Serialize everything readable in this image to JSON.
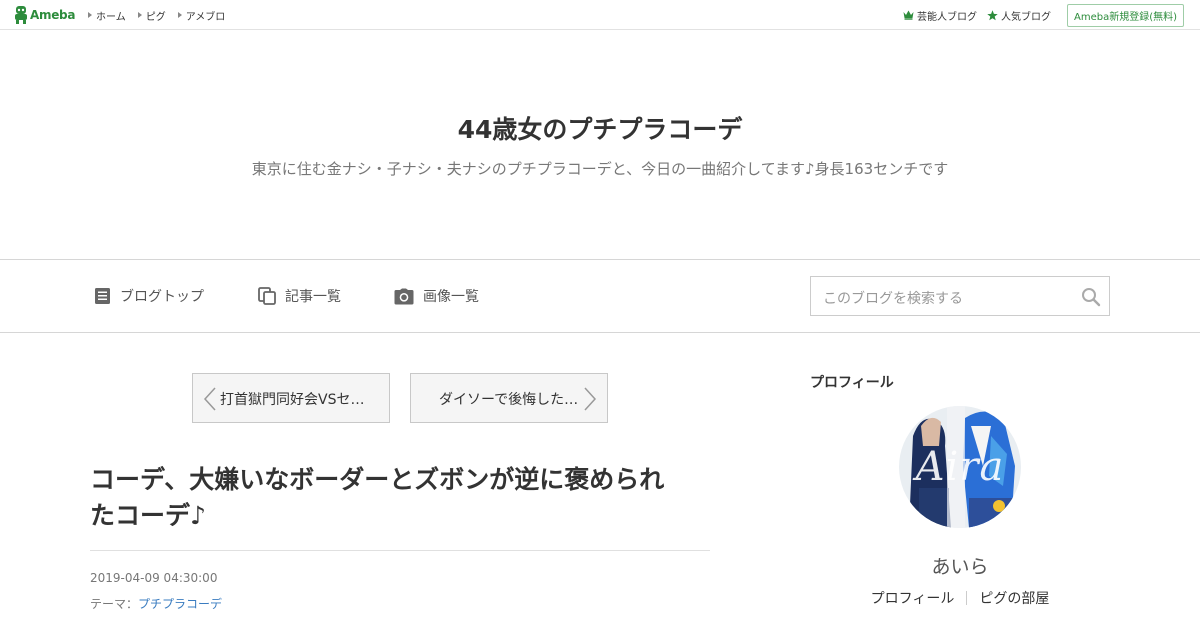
{
  "topbar": {
    "logo_text": "Ameba",
    "links": [
      "ホーム",
      "ピグ",
      "アメブロ"
    ],
    "right_links": [
      "芸能人ブログ",
      "人気ブログ"
    ],
    "signup_label": "Ameba新規登録(無料)",
    "brand_color": "#2d8c3c"
  },
  "header": {
    "title": "44歳女のプチプラコーデ",
    "description": "東京に住む金ナシ・子ナシ・夫ナシのプチプラコーデと、今日の一曲紹介してます♪身長163センチです"
  },
  "nav": {
    "items": [
      {
        "label": "ブログトップ",
        "icon": "document-icon"
      },
      {
        "label": "記事一覧",
        "icon": "copy-icon"
      },
      {
        "label": "画像一覧",
        "icon": "camera-icon"
      }
    ],
    "search_placeholder": "このブログを検索する"
  },
  "pager": {
    "prev_label": "打首獄門同好会VSセ…",
    "next_label": "ダイソーで後悔した…"
  },
  "article": {
    "title_line1": "コーデ、大嫌いなボーダーとズボンが逆に褒められ",
    "title_line2": "たコーデ♪",
    "date": "2019-04-09 04:30:00",
    "theme_prefix": "テーマ：",
    "theme_link": "プチプラコーデ"
  },
  "sidebar": {
    "heading": "プロフィール",
    "avatar_overlay_text": "Aira",
    "username": "あいら",
    "links": [
      "プロフィール",
      "ピグの部屋"
    ]
  }
}
